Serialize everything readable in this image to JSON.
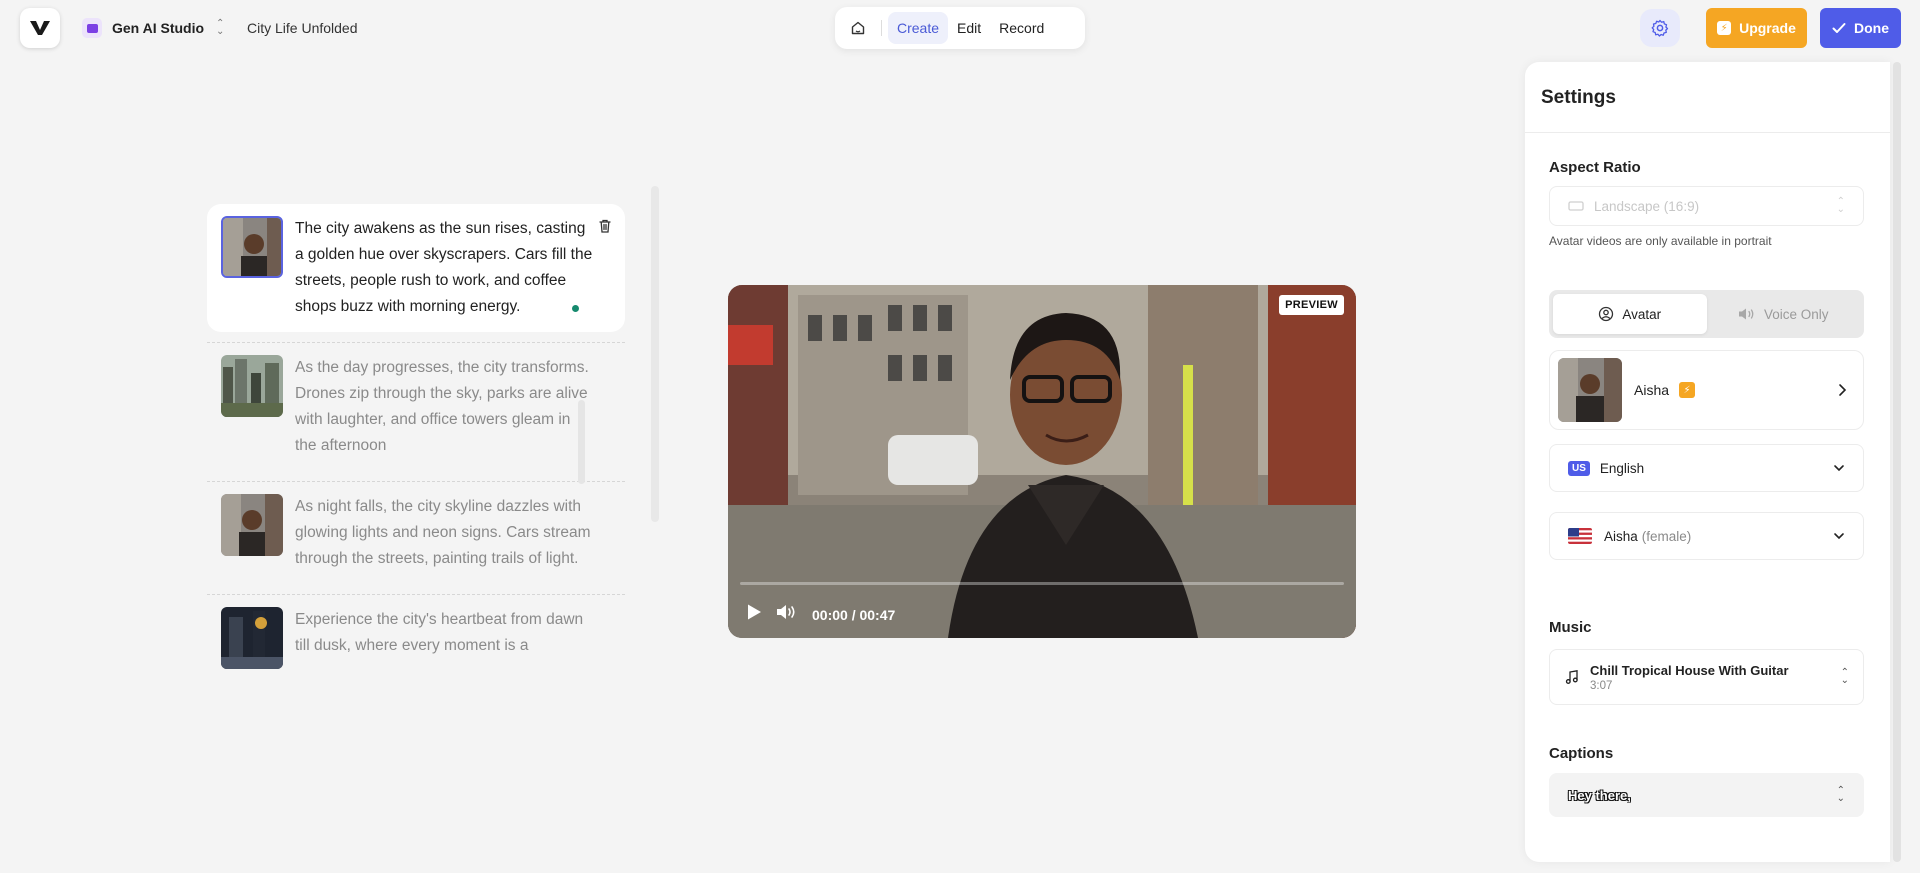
{
  "header": {
    "workspace_name": "Gen AI Studio",
    "project_title": "City Life Unfolded",
    "modes": [
      "Create",
      "Edit",
      "Record"
    ],
    "active_mode": "Create",
    "upgrade_label": "Upgrade",
    "done_label": "Done"
  },
  "scenes": [
    {
      "text": "The city awakens as the sun rises, casting a golden hue over skyscrapers. Cars fill the streets, people rush to work, and coffee shops buzz with morning energy.",
      "active": true
    },
    {
      "text": "As the day progresses, the city transforms. Drones zip through the sky, parks are alive with laughter, and office towers gleam in the afternoon",
      "active": false
    },
    {
      "text": "As night falls, the city skyline dazzles with glowing lights and neon signs. Cars stream through the streets, painting trails of light.",
      "active": false
    },
    {
      "text": "Experience the city's heartbeat from dawn till dusk, where every moment is a",
      "active": false
    }
  ],
  "video": {
    "badge": "PREVIEW",
    "time": "00:00 / 00:47",
    "progress": 0
  },
  "settings": {
    "title": "Settings",
    "aspect_ratio": {
      "label": "Aspect Ratio",
      "value": "Landscape (16:9)",
      "hint": "Avatar videos are only available in portrait"
    },
    "mode_toggle": {
      "options": [
        "Avatar",
        "Voice Only"
      ],
      "selected": "Avatar"
    },
    "avatar": {
      "name": "Aisha"
    },
    "language": {
      "badge": "US",
      "value": "English"
    },
    "voice": {
      "name": "Aisha",
      "gender": "(female)"
    },
    "music": {
      "label": "Music",
      "title": "Chill Tropical House With Guitar",
      "duration": "3:07"
    },
    "captions": {
      "label": "Captions",
      "sample": "Hey there,"
    }
  },
  "colors": {
    "accent": "#4f5ce8",
    "upgrade": "#f5a623",
    "active_dot": "#168a6e"
  }
}
